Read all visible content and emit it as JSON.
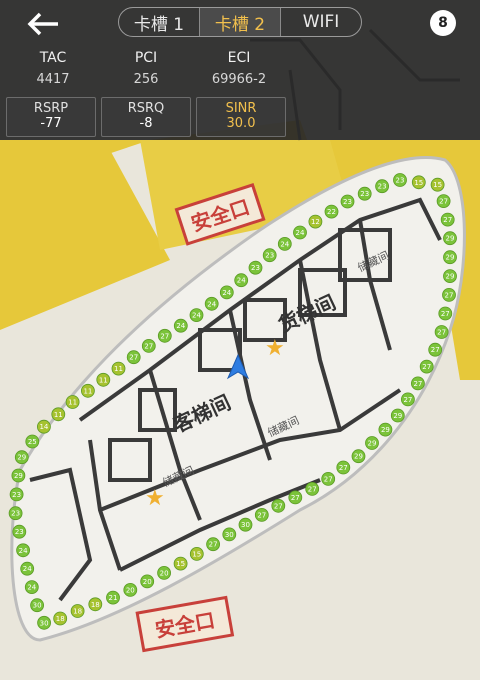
{
  "tabs": [
    {
      "label": "卡槽 1",
      "active": false
    },
    {
      "label": "卡槽 2",
      "active": true
    },
    {
      "label": "WIFI",
      "active": false
    }
  ],
  "badge": "8",
  "cell_info": {
    "tac": {
      "label": "TAC",
      "value": "4417"
    },
    "pci": {
      "label": "PCI",
      "value": "256"
    },
    "eci": {
      "label": "ECI",
      "value": "69966-2"
    }
  },
  "signal": {
    "rsrp": {
      "label": "RSRP",
      "value": "-77"
    },
    "rsrq": {
      "label": "RSRQ",
      "value": "-8"
    },
    "sinr": {
      "label": "SINR",
      "value": "30.0"
    }
  },
  "map_labels": {
    "exit_top": "安全口",
    "exit_bottom": "安全口",
    "passenger_elevator": "客梯间",
    "cargo_elevator": "货梯间",
    "storage": "储藏间"
  },
  "trace_values": [
    "23",
    "15",
    "15",
    "27",
    "27",
    "29",
    "29",
    "29",
    "27",
    "27",
    "27",
    "27",
    "27",
    "27",
    "27",
    "29",
    "29",
    "29",
    "29",
    "27",
    "27",
    "27",
    "27",
    "27",
    "27",
    "30",
    "30",
    "27",
    "15",
    "15",
    "20",
    "20",
    "20",
    "21",
    "18",
    "18",
    "18",
    "30",
    "30",
    "24",
    "24",
    "24",
    "23",
    "23",
    "23",
    "29",
    "29",
    "25",
    "14",
    "11",
    "11",
    "11",
    "11",
    "11",
    "27",
    "27",
    "27",
    "24",
    "24",
    "24",
    "24",
    "24",
    "23",
    "23",
    "24",
    "24",
    "12",
    "22",
    "23",
    "23",
    "23"
  ],
  "colors": {
    "accent": "#f2c04d",
    "trace": "#8bc53f",
    "wall": "#3a3a3a",
    "exit": "#c8403a",
    "floor_yellow": "#e6c83a"
  }
}
